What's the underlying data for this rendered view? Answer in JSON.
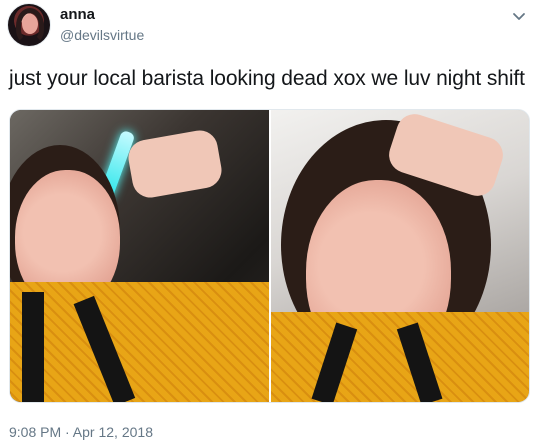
{
  "user": {
    "name": "anna",
    "handle": "@devilsvirtue"
  },
  "tweet": {
    "text": "just your local barista looking dead xox we luv night shift",
    "timestamp": "9:08 PM · Apr 12, 2018"
  },
  "media": {
    "photos": [
      {
        "subject": "selfie-left"
      },
      {
        "subject": "selfie-right"
      }
    ]
  },
  "colors": {
    "text": "#14171a",
    "secondary": "#657786",
    "shirt": "#e8a516",
    "apron": "#141414"
  },
  "icons": {
    "more": "chevron-down-icon"
  }
}
